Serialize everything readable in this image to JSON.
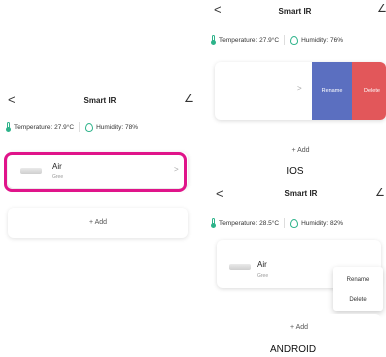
{
  "colors": {
    "accent_green": "#2db38a",
    "highlight_magenta": "#e0148a",
    "rename_blue": "#5b6fc0",
    "delete_red": "#e2575a"
  },
  "icons": {
    "back": "‹",
    "edit": "✎",
    "chevron": "›",
    "thermometer": "thermometer-icon",
    "humidity": "humidity-drop-icon",
    "device": "air-conditioner-icon"
  },
  "left": {
    "back_symbol": "<",
    "title": "Smart IR",
    "edit_symbol": "∠",
    "temperature_label": "Temperature:",
    "temperature_value": "27.9°C",
    "humidity_label": "Humidity:",
    "humidity_value": "78%",
    "device_name": "Air",
    "device_room": "Gree",
    "chevron": ">",
    "add_label": "+ Add"
  },
  "ios": {
    "back_symbol": "<",
    "title": "Smart IR",
    "edit_symbol": "∠",
    "temperature_label": "Temperature:",
    "temperature_value": "27.9°C",
    "humidity_label": "Humidity:",
    "humidity_value": "76%",
    "chevron": ">",
    "rename_label": "Rename",
    "delete_label": "Delete",
    "add_label": "+ Add",
    "caption": "IOS"
  },
  "android": {
    "back_symbol": "<",
    "title": "Smart IR",
    "edit_symbol": "∠",
    "temperature_label": "Temperature:",
    "temperature_value": "28.5°C",
    "humidity_label": "Humidity:",
    "humidity_value": "82%",
    "device_name": "Air",
    "device_room": "Gree",
    "rename_label": "Rename",
    "delete_label": "Delete",
    "add_label": "+ Add",
    "caption": "ANDROID"
  }
}
